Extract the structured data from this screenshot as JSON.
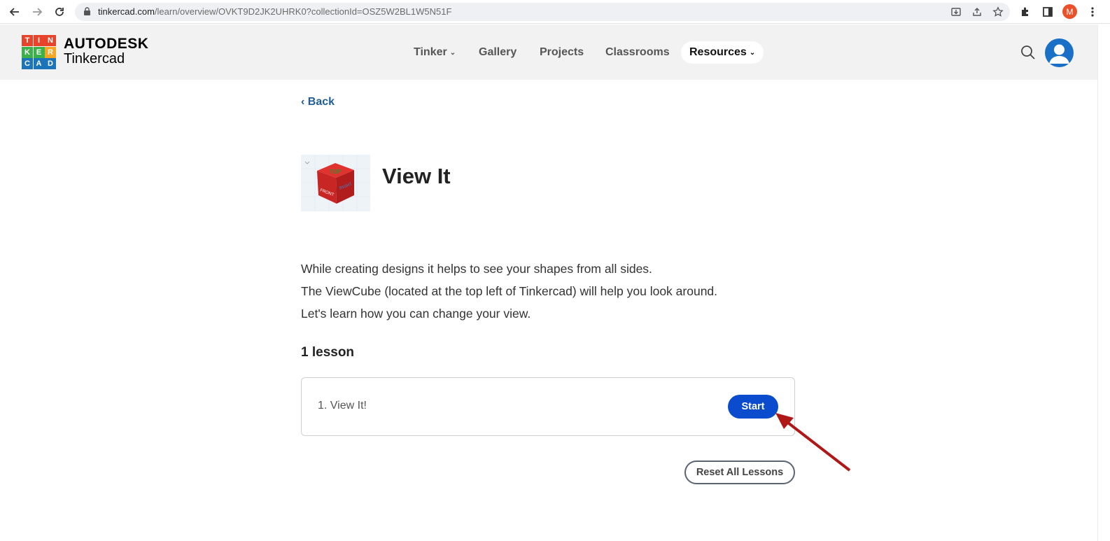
{
  "browser": {
    "url_domain": "tinkercad.com",
    "url_path": "/learn/overview/OVKT9D2JK2UHRK0?collectionId=OSZ5W2BL1W5N51F",
    "profile_initial": "M"
  },
  "header": {
    "logo_letters": [
      "T",
      "I",
      "N",
      "K",
      "E",
      "R",
      "C",
      "A",
      "D"
    ],
    "logo_colors": [
      "#e8442b",
      "#e8442b",
      "#e8442b",
      "#3cb14a",
      "#3cb14a",
      "#f5a623",
      "#1c74bb",
      "#1c74bb",
      "#1c74bb"
    ],
    "brand_top": "AUTODESK",
    "brand_bottom": "Tinkercad",
    "nav": [
      {
        "label": "Tinker",
        "has_dropdown": true
      },
      {
        "label": "Gallery",
        "has_dropdown": false
      },
      {
        "label": "Projects",
        "has_dropdown": false
      },
      {
        "label": "Classrooms",
        "has_dropdown": false
      },
      {
        "label": "Resources",
        "has_dropdown": true,
        "active": true
      }
    ]
  },
  "page": {
    "back_label": "‹ Back",
    "title": "View It",
    "description": [
      "While creating designs it helps to see your shapes from all sides.",
      "The ViewCube (located at the top left of Tinkercad) will help you look around.",
      "Let's learn how you can change your view."
    ],
    "lesson_count": "1 lesson",
    "lessons": [
      {
        "name": "1. View It!",
        "action": "Start"
      }
    ],
    "reset_label": "Reset All Lessons"
  },
  "colors": {
    "accent_blue": "#0b4cce",
    "link_blue": "#1f5c99",
    "annotation_arrow": "#b01818"
  }
}
